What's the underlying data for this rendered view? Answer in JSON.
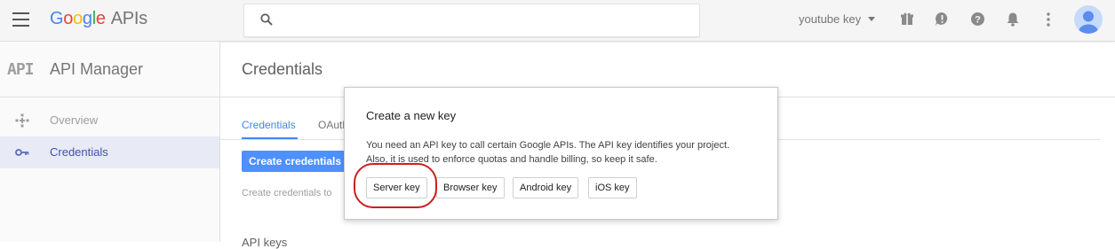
{
  "header": {
    "logo": {
      "g1": "G",
      "g2": "o",
      "g3": "o",
      "g4": "g",
      "g5": "l",
      "g6": "e",
      "product": "APIs"
    },
    "search": {
      "placeholder": "",
      "value": ""
    },
    "project": "youtube key",
    "icons": [
      "gift-icon",
      "feedback-icon",
      "help-icon",
      "notifications-icon",
      "more-vert-icon"
    ]
  },
  "sidebar": {
    "mark": "API",
    "title": "API Manager",
    "items": [
      {
        "label": "Overview",
        "icon": "overview-icon",
        "active": false
      },
      {
        "label": "Credentials",
        "icon": "key-icon",
        "active": true
      }
    ]
  },
  "main": {
    "title": "Credentials",
    "tabs": [
      {
        "label": "Credentials",
        "active": true
      },
      {
        "label": "OAuth",
        "active": false
      }
    ],
    "create_button": "Create credentials",
    "hint": "Create credentials to",
    "section": "API keys"
  },
  "dialog": {
    "title": "Create a new key",
    "body": "You need an API key to call certain Google APIs. The API key identifies your project. Also, it is used to enforce quotas and handle billing, so keep it safe.",
    "buttons": [
      {
        "label": "Server key"
      },
      {
        "label": "Browser key"
      },
      {
        "label": "Android key"
      },
      {
        "label": "iOS key"
      }
    ]
  },
  "colors": {
    "accent": "#4285f4",
    "button": "#4d90fe",
    "highlight": "#cc1f1f"
  }
}
